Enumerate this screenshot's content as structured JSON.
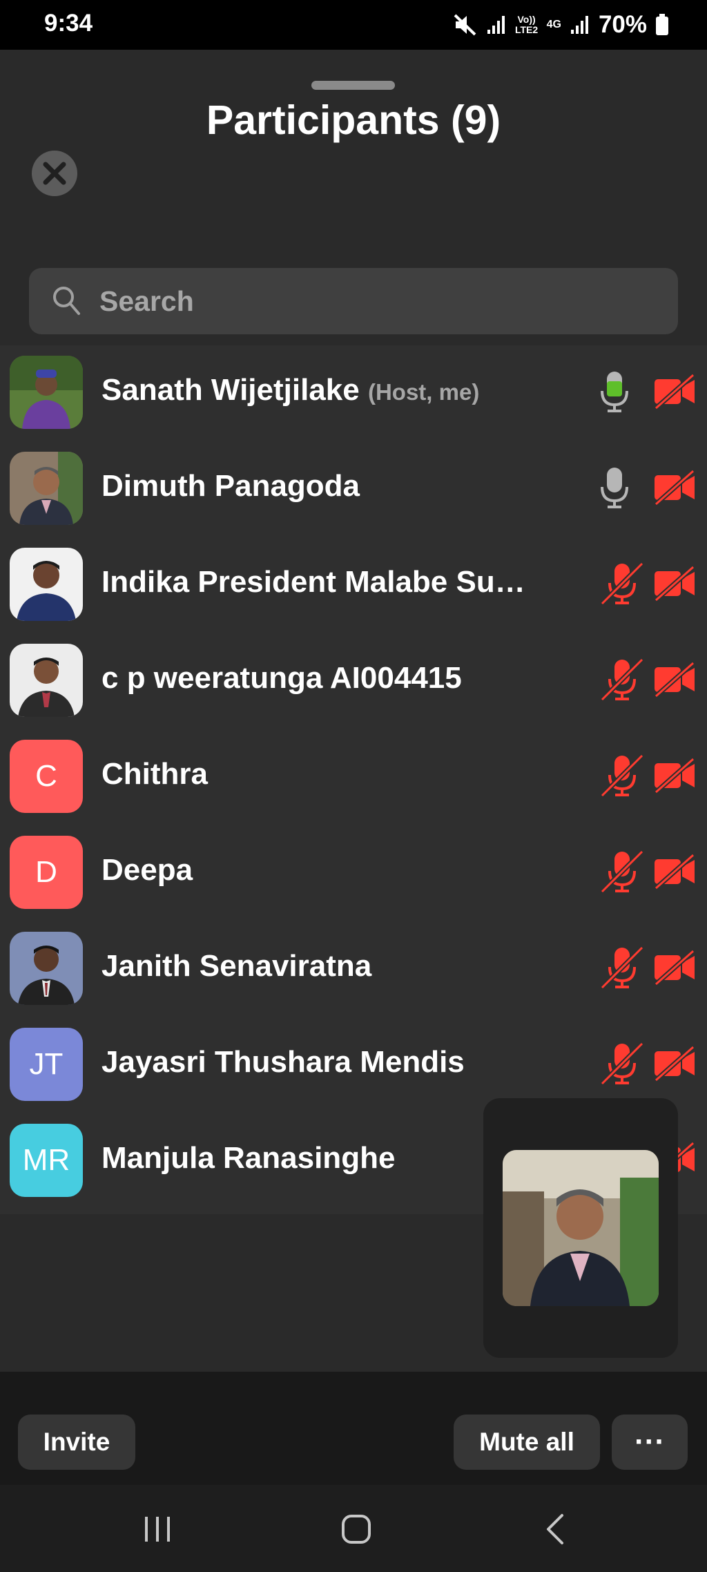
{
  "status_bar": {
    "time": "9:34",
    "network_label_1": "Vo)) LTE2",
    "network_label_2": "4G",
    "battery_text": "70%",
    "icons": [
      "mute-icon",
      "signal-icon",
      "signal-icon",
      "battery-icon"
    ]
  },
  "header": {
    "title": "Participants (9)",
    "close_icon": "close-icon"
  },
  "search": {
    "placeholder": "Search",
    "value": ""
  },
  "colors": {
    "mic_active": "#5fbf2a",
    "muted_red": "#ff3b30",
    "avatar_red": "#ff5a5a",
    "avatar_blue": "#7b88d8",
    "avatar_cyan": "#47cde0"
  },
  "participants": [
    {
      "name": "Sanath Wijetjilake",
      "tag": "(Host, me)",
      "avatar": "photo",
      "mic": "active",
      "video": "off"
    },
    {
      "name": "Dimuth Panagoda",
      "tag": "",
      "avatar": "photo",
      "mic": "on",
      "video": "off"
    },
    {
      "name": "Indika President Malabe Su…",
      "tag": "",
      "avatar": "photo",
      "mic": "muted",
      "video": "off"
    },
    {
      "name": "c p weeratunga AI004415",
      "tag": "",
      "avatar": "photo",
      "mic": "muted",
      "video": "off"
    },
    {
      "name": "Chithra",
      "tag": "",
      "initials": "C",
      "mic": "muted",
      "video": "off"
    },
    {
      "name": "Deepa",
      "tag": "",
      "initials": "D",
      "mic": "muted",
      "video": "off"
    },
    {
      "name": "Janith Senaviratna",
      "tag": "",
      "avatar": "photo",
      "mic": "muted",
      "video": "off"
    },
    {
      "name": "Jayasri Thushara Mendis",
      "tag": "",
      "initials": "JT",
      "mic": "muted",
      "video": "off"
    },
    {
      "name": "Manjula Ranasinghe",
      "tag": "",
      "initials": "MR",
      "mic": "hidden",
      "video": "off"
    }
  ],
  "footer": {
    "invite_label": "Invite",
    "mute_all_label": "Mute all",
    "more_label": "···"
  },
  "nav": [
    "recent-apps-icon",
    "home-icon",
    "back-icon"
  ]
}
